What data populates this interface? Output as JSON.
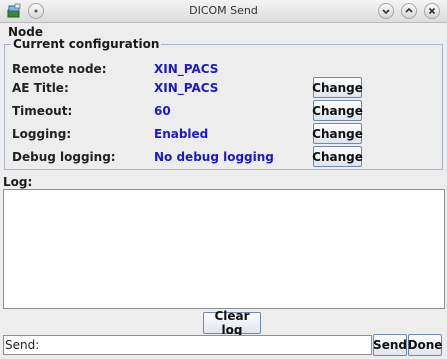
{
  "window": {
    "title": "DICOM Send"
  },
  "menu": {
    "node_label": "Node"
  },
  "config": {
    "legend": "Current configuration",
    "rows": [
      {
        "label": "Remote node:",
        "value": "XIN_PACS"
      },
      {
        "label": "AE Title:",
        "value": "XIN_PACS",
        "button": "Change"
      },
      {
        "label": "Timeout:",
        "value": "60",
        "button": "Change"
      },
      {
        "label": "Logging:",
        "value": "Enabled",
        "button": "Change"
      },
      {
        "label": "Debug logging:",
        "value": "No debug logging",
        "button": "Change"
      }
    ]
  },
  "log": {
    "label": "Log:",
    "clear_label": "Clear log"
  },
  "send": {
    "label": "Send:",
    "send_label": "Send",
    "done_label": "Done"
  },
  "icons": {
    "app": "app-icon",
    "menu": "window-menu-icon",
    "minimize": "minimize-icon",
    "maximize": "maximize-icon",
    "close": "close-icon"
  },
  "colors": {
    "value_text": "#1a1ac8",
    "button_border": "#6f8ab0",
    "window_bg": "#ededed"
  }
}
